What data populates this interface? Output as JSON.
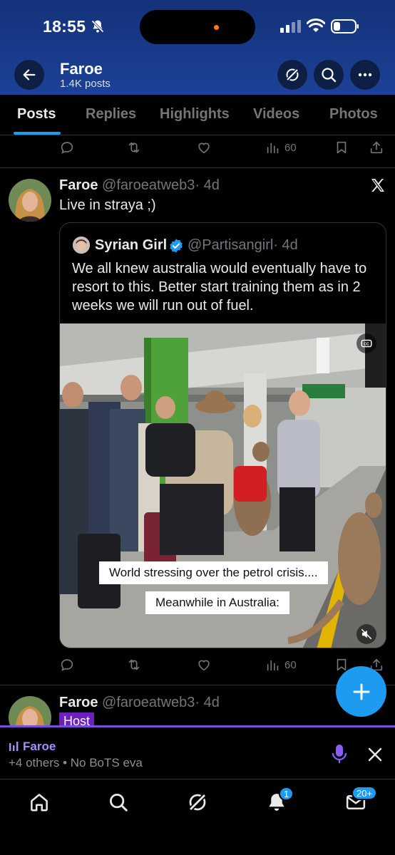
{
  "status_bar": {
    "time": "18:55"
  },
  "header": {
    "title": "Faroe",
    "subtitle": "1.4K posts"
  },
  "tabs": [
    {
      "label": "Posts"
    },
    {
      "label": "Replies"
    },
    {
      "label": "Highlights"
    },
    {
      "label": "Videos"
    },
    {
      "label": "Photos"
    }
  ],
  "prev_post": {
    "views": "60"
  },
  "post": {
    "author_name": "Faroe",
    "author_handle": "@faroeatweb3",
    "age": "· 4d",
    "text": "Live in straya ;)",
    "quote": {
      "author_name": "Syrian Girl",
      "author_handle": "@Partisangirl",
      "age": "· 4d",
      "text": "We all knew australia would eventually have to resort to this. Better start training them as in 2 weeks we will run out of fuel.",
      "captions": [
        "World stressing over the petrol crisis....",
        "Meanwhile in Australia:"
      ]
    },
    "views": "60"
  },
  "next_post": {
    "author_name": "Faroe",
    "author_handle": "@faroeatweb3",
    "age": "· 4d",
    "badge": "Host"
  },
  "space_bar": {
    "title": "Faroe",
    "subtitle": "+4 others • No BoTS eva"
  },
  "bottom_nav": {
    "notifications_badge": "1",
    "messages_badge": "20+"
  },
  "colors": {
    "accent": "#1d9bf0",
    "header_bg": "#1c4196",
    "spaces_purple": "#7c4ddc"
  },
  "icons": [
    "back-arrow-icon",
    "grok-icon",
    "search-icon",
    "more-icon",
    "reply-icon",
    "repost-icon",
    "like-icon",
    "views-icon",
    "bookmark-icon",
    "share-icon",
    "x-logo-icon",
    "verified-icon",
    "captions-icon",
    "mute-icon",
    "plus-icon",
    "mic-icon",
    "close-icon",
    "home-icon",
    "bell-icon",
    "mail-icon"
  ]
}
